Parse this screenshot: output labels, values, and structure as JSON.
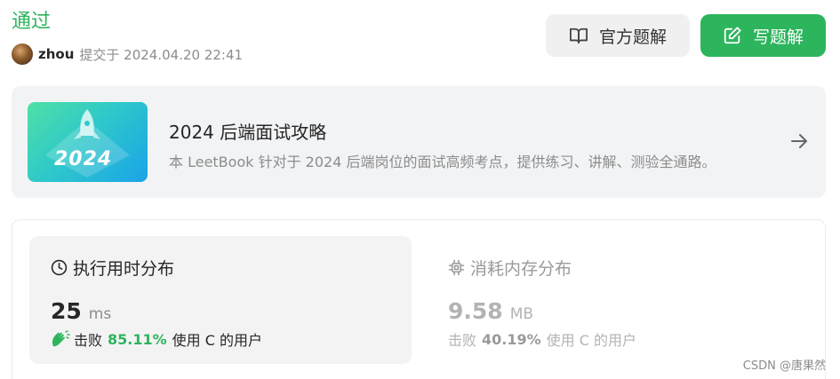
{
  "submission": {
    "status": "通过",
    "username": "zhou",
    "submitted_text": "提交于 2024.04.20 22:41"
  },
  "actions": {
    "official_solution_label": "官方题解",
    "write_solution_label": "写题解"
  },
  "book": {
    "cover_year": "2024",
    "title": "2024 后端面试攻略",
    "description": "本 LeetBook 针对于 2024 后端岗位的面试高频考点，提供练习、讲解、测验全通路。"
  },
  "runtime": {
    "title": "执行用时分布",
    "value": "25",
    "unit": "ms",
    "beat_prefix": "击败",
    "beat_pct": "85.11%",
    "beat_suffix": "使用 C 的用户"
  },
  "memory": {
    "title": "消耗内存分布",
    "value": "9.58",
    "unit": "MB",
    "beat_prefix": "击败",
    "beat_pct": "40.19%",
    "beat_suffix": "使用 C 的用户"
  },
  "watermark": "CSDN @唐果然",
  "colors": {
    "accent": "#2db55d",
    "muted": "#8c8c8c",
    "card_bg": "#f3f3f3"
  }
}
